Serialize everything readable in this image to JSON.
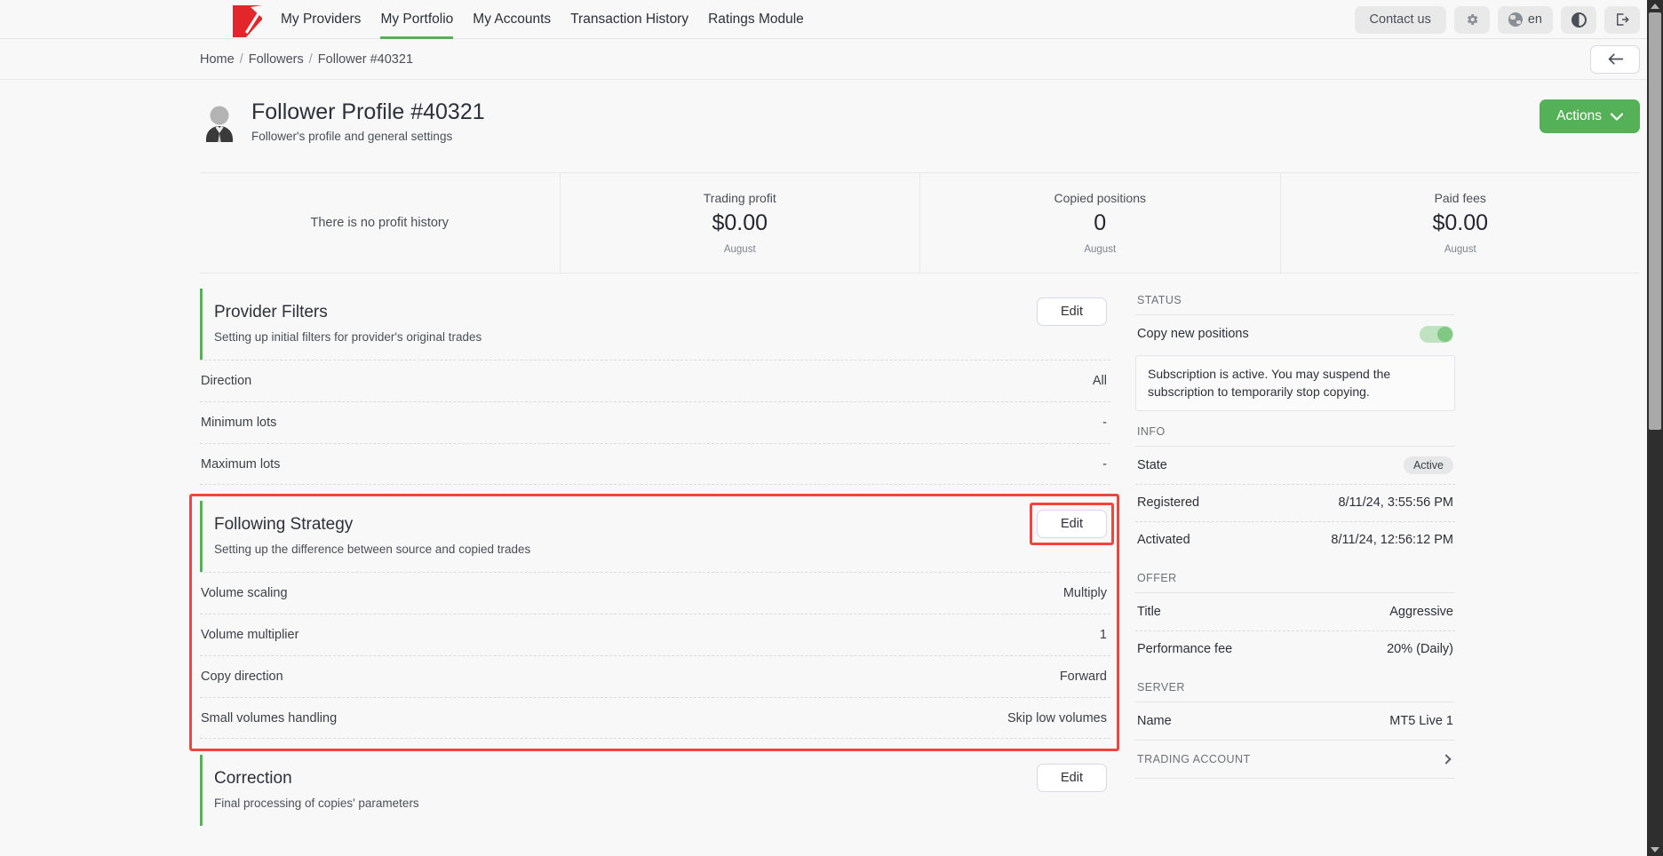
{
  "nav": {
    "logo_icon": "brand-logo-icon",
    "links": [
      {
        "label": "My Providers",
        "active": false
      },
      {
        "label": "My Portfolio",
        "active": true
      },
      {
        "label": "My Accounts",
        "active": false
      },
      {
        "label": "Transaction History",
        "active": false
      },
      {
        "label": "Ratings Module",
        "active": false
      }
    ],
    "contact_label": "Contact us",
    "settings_icon": "gear-icon",
    "language": "en",
    "language_icon": "globe-icon",
    "theme_icon": "contrast-icon",
    "logout_icon": "logout-icon"
  },
  "breadcrumb": {
    "items": [
      "Home",
      "Followers",
      "Follower #40321"
    ],
    "separator": "/",
    "back_icon": "arrow-left-icon"
  },
  "page": {
    "title": "Follower Profile #40321",
    "subtitle": "Follower's profile and general settings",
    "avatar_icon": "user-avatar-icon",
    "actions_label": "Actions",
    "actions_icon": "chevron-down-icon",
    "accent_green": "#55b158",
    "highlight_red": "#f4433a"
  },
  "stats": {
    "empty_message": "There is no profit history",
    "items": [
      {
        "label": "Trading profit",
        "value": "$0.00",
        "period": "August"
      },
      {
        "label": "Copied positions",
        "value": "0",
        "period": "August"
      },
      {
        "label": "Paid fees",
        "value": "$0.00",
        "period": "August"
      }
    ]
  },
  "sections": [
    {
      "title": "Provider Filters",
      "desc": "Setting up initial filters for provider's original trades",
      "edit_label": "Edit",
      "rows": [
        {
          "key": "Direction",
          "value": "All"
        },
        {
          "key": "Minimum lots",
          "value": "-"
        },
        {
          "key": "Maximum lots",
          "value": "-"
        }
      ]
    },
    {
      "title": "Following Strategy",
      "desc": "Setting up the difference between source and copied trades",
      "edit_label": "Edit",
      "rows": [
        {
          "key": "Volume scaling",
          "value": "Multiply"
        },
        {
          "key": "Volume multiplier",
          "value": "1"
        },
        {
          "key": "Copy direction",
          "value": "Forward"
        },
        {
          "key": "Small volumes handling",
          "value": "Skip low volumes"
        }
      ]
    },
    {
      "title": "Correction",
      "desc": "Final processing of copies' parameters",
      "edit_label": "Edit",
      "rows": []
    }
  ],
  "sidebar": {
    "status_label": "STATUS",
    "copy_new_positions_label": "Copy new positions",
    "copy_new_positions_on": true,
    "notice": "Subscription is active. You may suspend the subscription to temporarily stop copying.",
    "info_label": "INFO",
    "info_rows": [
      {
        "key": "State",
        "value": "Active",
        "badge": true
      },
      {
        "key": "Registered",
        "value": "8/11/24, 3:55:56 PM",
        "badge": false
      },
      {
        "key": "Activated",
        "value": "8/11/24, 12:56:12 PM",
        "badge": false
      }
    ],
    "offer_label": "OFFER",
    "offer_rows": [
      {
        "key": "Title",
        "value": "Aggressive"
      },
      {
        "key": "Performance fee",
        "value": "20% (Daily)"
      }
    ],
    "server_label": "SERVER",
    "server_rows": [
      {
        "key": "Name",
        "value": "MT5 Live 1"
      }
    ],
    "trading_account_label": "TRADING ACCOUNT",
    "trading_account_icon": "chevron-right-icon"
  }
}
